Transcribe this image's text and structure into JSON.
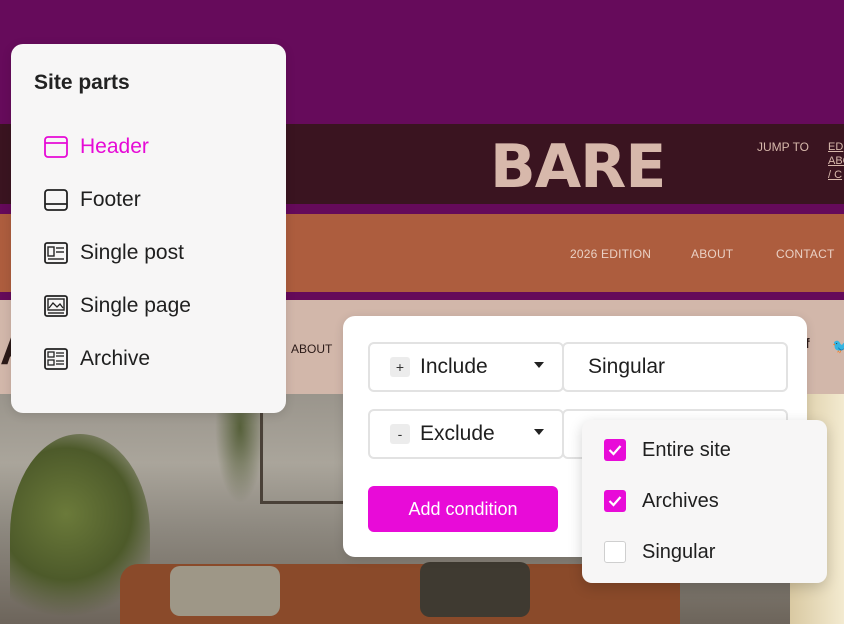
{
  "background_site": {
    "logo": "BARE",
    "jump_to": "JUMP TO",
    "jump_links": [
      "ED",
      "ABO",
      "/ C"
    ],
    "nav": [
      "2026 EDITION",
      "ABOUT",
      "CONTACT"
    ],
    "sub_nav_about": "ABOUT",
    "sub_left_glyph": "A",
    "social_f": "f",
    "social_tw": "🐦"
  },
  "site_parts": {
    "title": "Site parts",
    "items": [
      {
        "label": "Header",
        "icon": "header-layout-icon",
        "active": true
      },
      {
        "label": "Footer",
        "icon": "footer-layout-icon",
        "active": false
      },
      {
        "label": "Single post",
        "icon": "single-post-icon",
        "active": false
      },
      {
        "label": "Single page",
        "icon": "single-page-icon",
        "active": false
      },
      {
        "label": "Archive",
        "icon": "archive-icon",
        "active": false
      }
    ]
  },
  "conditions": {
    "rows": [
      {
        "sign": "+",
        "type": "Include",
        "value": "Singular"
      },
      {
        "sign": "-",
        "type": "Exclude",
        "value": ""
      }
    ],
    "add_label": "Add condition"
  },
  "dropdown": {
    "options": [
      {
        "label": "Entire site",
        "checked": true
      },
      {
        "label": "Archives",
        "checked": true
      },
      {
        "label": "Singular",
        "checked": false
      }
    ]
  },
  "colors": {
    "accent": "#e80bd8",
    "bg_purple": "#650a5a",
    "header_dark": "#3a1420",
    "nav_orange": "#ad5d3e"
  }
}
